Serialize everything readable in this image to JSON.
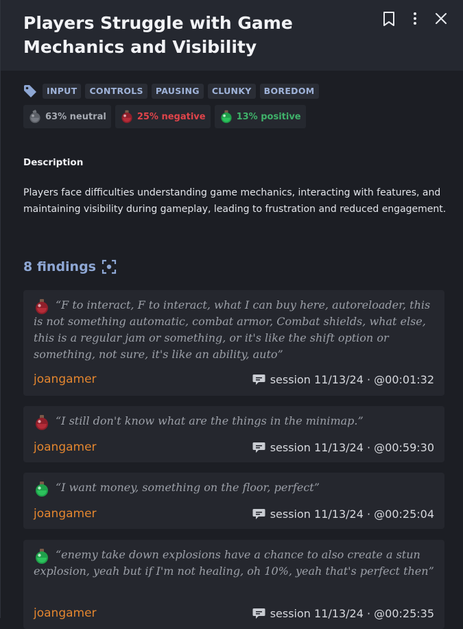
{
  "header": {
    "title": "Players Struggle with Game Mechanics and Visibility",
    "icons": [
      "bookmark-icon",
      "more-vertical-icon",
      "close-icon"
    ]
  },
  "tags": [
    "INPUT",
    "CONTROLS",
    "PAUSING",
    "CLUNKY",
    "BOREDOM"
  ],
  "sentiment": {
    "neutral": "63% neutral",
    "negative": "25% negative",
    "positive": "13% positive"
  },
  "description": {
    "heading": "Description",
    "text": "Players face difficulties understanding game mechanics, interacting with features, and maintaining visibility during gameplay, leading to frustration and reduced engagement."
  },
  "findings": {
    "count_label": "8 findings",
    "items": [
      {
        "sentiment": "negative",
        "quote": "“F to interact, F to interact, what I can buy here, autoreloader, this is not something automatic, combat armor, Combat shields, what else, this is a regular jam or something, or it's like the shift option or something, not sure, it's like an ability, auto”",
        "author": "joangamer",
        "session": "session 11/13/24 · @00:01:32"
      },
      {
        "sentiment": "negative",
        "quote": "“I still don't know what are the things in the minimap.”",
        "author": "joangamer",
        "session": "session 11/13/24 · @00:59:30"
      },
      {
        "sentiment": "positive",
        "quote": "“I want money, something on the floor, perfect”",
        "author": "joangamer",
        "session": "session 11/13/24 · @00:25:04"
      },
      {
        "sentiment": "positive",
        "quote": "“enemy take down explosions have a chance to also create a stun explosion, yeah but if I'm not healing, oh 10%, yeah that's perfect then”",
        "author": "joangamer",
        "session": "session 11/13/24 · @00:25:35"
      }
    ]
  },
  "colors": {
    "neutral": "#a7abb3",
    "negative": "#e0444a",
    "positive": "#3fb26a",
    "author": "#e4862f",
    "accent": "#8ea7d4"
  }
}
